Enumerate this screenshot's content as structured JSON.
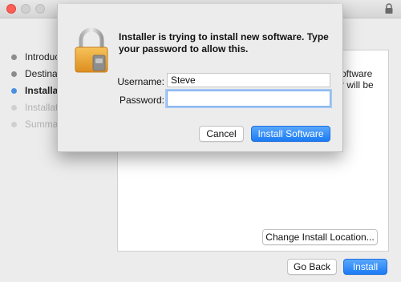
{
  "window": {
    "panel_text": "oftware\nr will be"
  },
  "sidebar": {
    "items": [
      {
        "label": "Introduction",
        "state": "done"
      },
      {
        "label": "Destination",
        "state": "done"
      },
      {
        "label": "Installation",
        "state": "current"
      },
      {
        "label": "Installation",
        "state": "future"
      },
      {
        "label": "Summary",
        "state": "future"
      }
    ]
  },
  "panel": {
    "change_location_label": "Change Install Location..."
  },
  "footer": {
    "go_back_label": "Go Back",
    "install_label": "Install"
  },
  "dialog": {
    "message": "Installer is trying to install new software. Type your password to allow this.",
    "username_label": "Username:",
    "username_value": "Steve",
    "password_label": "Password:",
    "password_value": "",
    "cancel_label": "Cancel",
    "confirm_label": "Install Software"
  },
  "colors": {
    "accent": "#1b7bf4",
    "close_light": "#fc5f57"
  }
}
